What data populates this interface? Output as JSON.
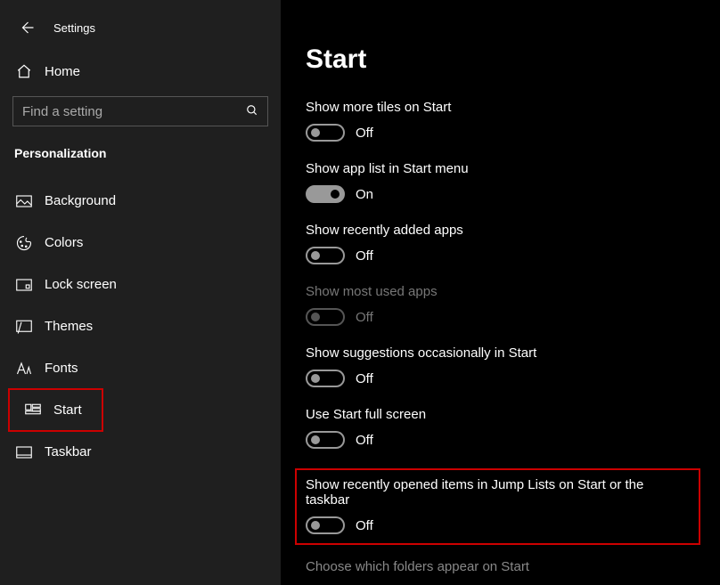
{
  "header": {
    "title": "Settings"
  },
  "sidebar": {
    "home_label": "Home",
    "search_placeholder": "Find a setting",
    "section_title": "Personalization",
    "items": [
      {
        "label": "Background"
      },
      {
        "label": "Colors"
      },
      {
        "label": "Lock screen"
      },
      {
        "label": "Themes"
      },
      {
        "label": "Fonts"
      },
      {
        "label": "Start"
      },
      {
        "label": "Taskbar"
      }
    ]
  },
  "main": {
    "page_title": "Start",
    "settings": [
      {
        "label": "Show more tiles on Start",
        "state": "Off"
      },
      {
        "label": "Show app list in Start menu",
        "state": "On"
      },
      {
        "label": "Show recently added apps",
        "state": "Off"
      },
      {
        "label": "Show most used apps",
        "state": "Off"
      },
      {
        "label": "Show suggestions occasionally in Start",
        "state": "Off"
      },
      {
        "label": "Use Start full screen",
        "state": "Off"
      },
      {
        "label": "Show recently opened items in Jump Lists on Start or the taskbar",
        "state": "Off"
      }
    ],
    "link": "Choose which folders appear on Start"
  }
}
